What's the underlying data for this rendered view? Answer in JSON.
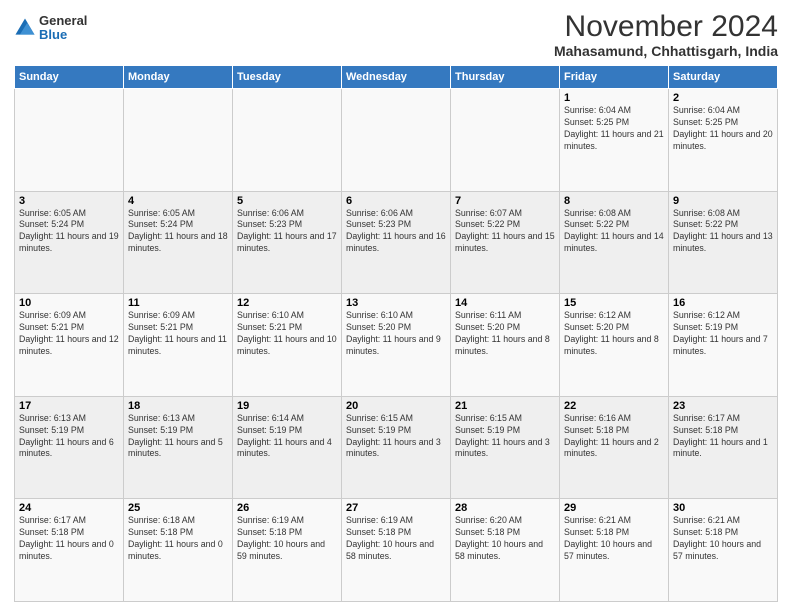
{
  "header": {
    "logo_general": "General",
    "logo_blue": "Blue",
    "month": "November 2024",
    "location": "Mahasamund, Chhattisgarh, India"
  },
  "days_of_week": [
    "Sunday",
    "Monday",
    "Tuesday",
    "Wednesday",
    "Thursday",
    "Friday",
    "Saturday"
  ],
  "weeks": [
    [
      {
        "day": "",
        "info": ""
      },
      {
        "day": "",
        "info": ""
      },
      {
        "day": "",
        "info": ""
      },
      {
        "day": "",
        "info": ""
      },
      {
        "day": "",
        "info": ""
      },
      {
        "day": "1",
        "info": "Sunrise: 6:04 AM\nSunset: 5:25 PM\nDaylight: 11 hours and 21 minutes."
      },
      {
        "day": "2",
        "info": "Sunrise: 6:04 AM\nSunset: 5:25 PM\nDaylight: 11 hours and 20 minutes."
      }
    ],
    [
      {
        "day": "3",
        "info": "Sunrise: 6:05 AM\nSunset: 5:24 PM\nDaylight: 11 hours and 19 minutes."
      },
      {
        "day": "4",
        "info": "Sunrise: 6:05 AM\nSunset: 5:24 PM\nDaylight: 11 hours and 18 minutes."
      },
      {
        "day": "5",
        "info": "Sunrise: 6:06 AM\nSunset: 5:23 PM\nDaylight: 11 hours and 17 minutes."
      },
      {
        "day": "6",
        "info": "Sunrise: 6:06 AM\nSunset: 5:23 PM\nDaylight: 11 hours and 16 minutes."
      },
      {
        "day": "7",
        "info": "Sunrise: 6:07 AM\nSunset: 5:22 PM\nDaylight: 11 hours and 15 minutes."
      },
      {
        "day": "8",
        "info": "Sunrise: 6:08 AM\nSunset: 5:22 PM\nDaylight: 11 hours and 14 minutes."
      },
      {
        "day": "9",
        "info": "Sunrise: 6:08 AM\nSunset: 5:22 PM\nDaylight: 11 hours and 13 minutes."
      }
    ],
    [
      {
        "day": "10",
        "info": "Sunrise: 6:09 AM\nSunset: 5:21 PM\nDaylight: 11 hours and 12 minutes."
      },
      {
        "day": "11",
        "info": "Sunrise: 6:09 AM\nSunset: 5:21 PM\nDaylight: 11 hours and 11 minutes."
      },
      {
        "day": "12",
        "info": "Sunrise: 6:10 AM\nSunset: 5:21 PM\nDaylight: 11 hours and 10 minutes."
      },
      {
        "day": "13",
        "info": "Sunrise: 6:10 AM\nSunset: 5:20 PM\nDaylight: 11 hours and 9 minutes."
      },
      {
        "day": "14",
        "info": "Sunrise: 6:11 AM\nSunset: 5:20 PM\nDaylight: 11 hours and 8 minutes."
      },
      {
        "day": "15",
        "info": "Sunrise: 6:12 AM\nSunset: 5:20 PM\nDaylight: 11 hours and 8 minutes."
      },
      {
        "day": "16",
        "info": "Sunrise: 6:12 AM\nSunset: 5:19 PM\nDaylight: 11 hours and 7 minutes."
      }
    ],
    [
      {
        "day": "17",
        "info": "Sunrise: 6:13 AM\nSunset: 5:19 PM\nDaylight: 11 hours and 6 minutes."
      },
      {
        "day": "18",
        "info": "Sunrise: 6:13 AM\nSunset: 5:19 PM\nDaylight: 11 hours and 5 minutes."
      },
      {
        "day": "19",
        "info": "Sunrise: 6:14 AM\nSunset: 5:19 PM\nDaylight: 11 hours and 4 minutes."
      },
      {
        "day": "20",
        "info": "Sunrise: 6:15 AM\nSunset: 5:19 PM\nDaylight: 11 hours and 3 minutes."
      },
      {
        "day": "21",
        "info": "Sunrise: 6:15 AM\nSunset: 5:19 PM\nDaylight: 11 hours and 3 minutes."
      },
      {
        "day": "22",
        "info": "Sunrise: 6:16 AM\nSunset: 5:18 PM\nDaylight: 11 hours and 2 minutes."
      },
      {
        "day": "23",
        "info": "Sunrise: 6:17 AM\nSunset: 5:18 PM\nDaylight: 11 hours and 1 minute."
      }
    ],
    [
      {
        "day": "24",
        "info": "Sunrise: 6:17 AM\nSunset: 5:18 PM\nDaylight: 11 hours and 0 minutes."
      },
      {
        "day": "25",
        "info": "Sunrise: 6:18 AM\nSunset: 5:18 PM\nDaylight: 11 hours and 0 minutes."
      },
      {
        "day": "26",
        "info": "Sunrise: 6:19 AM\nSunset: 5:18 PM\nDaylight: 10 hours and 59 minutes."
      },
      {
        "day": "27",
        "info": "Sunrise: 6:19 AM\nSunset: 5:18 PM\nDaylight: 10 hours and 58 minutes."
      },
      {
        "day": "28",
        "info": "Sunrise: 6:20 AM\nSunset: 5:18 PM\nDaylight: 10 hours and 58 minutes."
      },
      {
        "day": "29",
        "info": "Sunrise: 6:21 AM\nSunset: 5:18 PM\nDaylight: 10 hours and 57 minutes."
      },
      {
        "day": "30",
        "info": "Sunrise: 6:21 AM\nSunset: 5:18 PM\nDaylight: 10 hours and 57 minutes."
      }
    ]
  ]
}
